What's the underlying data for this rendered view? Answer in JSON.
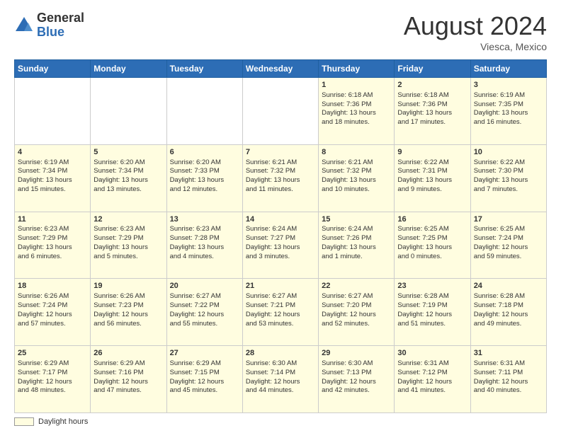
{
  "header": {
    "logo_general": "General",
    "logo_blue": "Blue",
    "month_title": "August 2024",
    "location": "Viesca, Mexico"
  },
  "weekdays": [
    "Sunday",
    "Monday",
    "Tuesday",
    "Wednesday",
    "Thursday",
    "Friday",
    "Saturday"
  ],
  "footer": {
    "label": "Daylight hours"
  },
  "weeks": [
    [
      {
        "day": "",
        "info": ""
      },
      {
        "day": "",
        "info": ""
      },
      {
        "day": "",
        "info": ""
      },
      {
        "day": "",
        "info": ""
      },
      {
        "day": "1",
        "info": "Sunrise: 6:18 AM\nSunset: 7:36 PM\nDaylight: 13 hours\nand 18 minutes."
      },
      {
        "day": "2",
        "info": "Sunrise: 6:18 AM\nSunset: 7:36 PM\nDaylight: 13 hours\nand 17 minutes."
      },
      {
        "day": "3",
        "info": "Sunrise: 6:19 AM\nSunset: 7:35 PM\nDaylight: 13 hours\nand 16 minutes."
      }
    ],
    [
      {
        "day": "4",
        "info": "Sunrise: 6:19 AM\nSunset: 7:34 PM\nDaylight: 13 hours\nand 15 minutes."
      },
      {
        "day": "5",
        "info": "Sunrise: 6:20 AM\nSunset: 7:34 PM\nDaylight: 13 hours\nand 13 minutes."
      },
      {
        "day": "6",
        "info": "Sunrise: 6:20 AM\nSunset: 7:33 PM\nDaylight: 13 hours\nand 12 minutes."
      },
      {
        "day": "7",
        "info": "Sunrise: 6:21 AM\nSunset: 7:32 PM\nDaylight: 13 hours\nand 11 minutes."
      },
      {
        "day": "8",
        "info": "Sunrise: 6:21 AM\nSunset: 7:32 PM\nDaylight: 13 hours\nand 10 minutes."
      },
      {
        "day": "9",
        "info": "Sunrise: 6:22 AM\nSunset: 7:31 PM\nDaylight: 13 hours\nand 9 minutes."
      },
      {
        "day": "10",
        "info": "Sunrise: 6:22 AM\nSunset: 7:30 PM\nDaylight: 13 hours\nand 7 minutes."
      }
    ],
    [
      {
        "day": "11",
        "info": "Sunrise: 6:23 AM\nSunset: 7:29 PM\nDaylight: 13 hours\nand 6 minutes."
      },
      {
        "day": "12",
        "info": "Sunrise: 6:23 AM\nSunset: 7:29 PM\nDaylight: 13 hours\nand 5 minutes."
      },
      {
        "day": "13",
        "info": "Sunrise: 6:23 AM\nSunset: 7:28 PM\nDaylight: 13 hours\nand 4 minutes."
      },
      {
        "day": "14",
        "info": "Sunrise: 6:24 AM\nSunset: 7:27 PM\nDaylight: 13 hours\nand 3 minutes."
      },
      {
        "day": "15",
        "info": "Sunrise: 6:24 AM\nSunset: 7:26 PM\nDaylight: 13 hours\nand 1 minute."
      },
      {
        "day": "16",
        "info": "Sunrise: 6:25 AM\nSunset: 7:25 PM\nDaylight: 13 hours\nand 0 minutes."
      },
      {
        "day": "17",
        "info": "Sunrise: 6:25 AM\nSunset: 7:24 PM\nDaylight: 12 hours\nand 59 minutes."
      }
    ],
    [
      {
        "day": "18",
        "info": "Sunrise: 6:26 AM\nSunset: 7:24 PM\nDaylight: 12 hours\nand 57 minutes."
      },
      {
        "day": "19",
        "info": "Sunrise: 6:26 AM\nSunset: 7:23 PM\nDaylight: 12 hours\nand 56 minutes."
      },
      {
        "day": "20",
        "info": "Sunrise: 6:27 AM\nSunset: 7:22 PM\nDaylight: 12 hours\nand 55 minutes."
      },
      {
        "day": "21",
        "info": "Sunrise: 6:27 AM\nSunset: 7:21 PM\nDaylight: 12 hours\nand 53 minutes."
      },
      {
        "day": "22",
        "info": "Sunrise: 6:27 AM\nSunset: 7:20 PM\nDaylight: 12 hours\nand 52 minutes."
      },
      {
        "day": "23",
        "info": "Sunrise: 6:28 AM\nSunset: 7:19 PM\nDaylight: 12 hours\nand 51 minutes."
      },
      {
        "day": "24",
        "info": "Sunrise: 6:28 AM\nSunset: 7:18 PM\nDaylight: 12 hours\nand 49 minutes."
      }
    ],
    [
      {
        "day": "25",
        "info": "Sunrise: 6:29 AM\nSunset: 7:17 PM\nDaylight: 12 hours\nand 48 minutes."
      },
      {
        "day": "26",
        "info": "Sunrise: 6:29 AM\nSunset: 7:16 PM\nDaylight: 12 hours\nand 47 minutes."
      },
      {
        "day": "27",
        "info": "Sunrise: 6:29 AM\nSunset: 7:15 PM\nDaylight: 12 hours\nand 45 minutes."
      },
      {
        "day": "28",
        "info": "Sunrise: 6:30 AM\nSunset: 7:14 PM\nDaylight: 12 hours\nand 44 minutes."
      },
      {
        "day": "29",
        "info": "Sunrise: 6:30 AM\nSunset: 7:13 PM\nDaylight: 12 hours\nand 42 minutes."
      },
      {
        "day": "30",
        "info": "Sunrise: 6:31 AM\nSunset: 7:12 PM\nDaylight: 12 hours\nand 41 minutes."
      },
      {
        "day": "31",
        "info": "Sunrise: 6:31 AM\nSunset: 7:11 PM\nDaylight: 12 hours\nand 40 minutes."
      }
    ]
  ]
}
